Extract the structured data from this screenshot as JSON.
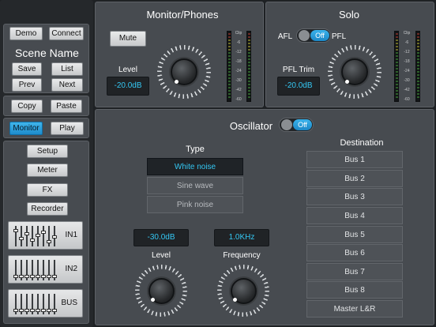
{
  "sidebar": {
    "demo": "Demo",
    "connect": "Connect",
    "scene_name": "Scene Name",
    "save": "Save",
    "list": "List",
    "prev": "Prev",
    "next": "Next",
    "copy": "Copy",
    "paste": "Paste",
    "monitor": "Monitor",
    "play": "Play",
    "setup": "Setup",
    "meter": "Meter",
    "fx": "FX",
    "recorder": "Recorder",
    "fader_in1": "IN1",
    "fader_in2": "IN2",
    "fader_bus": "BUS"
  },
  "monitor": {
    "title": "Monitor/Phones",
    "mute": "Mute",
    "level_label": "Level",
    "level_value": "-20.0dB",
    "scale": [
      "Clip",
      "-6",
      "-12",
      "-18",
      "-24",
      "-30",
      "-42",
      "-60"
    ]
  },
  "solo": {
    "title": "Solo",
    "afl": "AFL",
    "pfl": "PFL",
    "toggle_state": "Off",
    "pfl_trim_label": "PFL Trim",
    "pfl_trim_value": "-20.0dB",
    "scale": [
      "Clip",
      "-6",
      "-12",
      "-18",
      "-24",
      "-30",
      "-42",
      "-60"
    ]
  },
  "oscillator": {
    "title": "Oscillator",
    "toggle_state": "Off",
    "type_label": "Type",
    "types": [
      "White noise",
      "Sine wave",
      "Pink noise"
    ],
    "selected_type": "White noise",
    "level_value": "-30.0dB",
    "level_label": "Level",
    "frequency_value": "1.0KHz",
    "frequency_label": "Frequency",
    "destination_label": "Destination",
    "destinations": [
      "Bus 1",
      "Bus 2",
      "Bus 3",
      "Bus 4",
      "Bus 5",
      "Bus 6",
      "Bus 7",
      "Bus 8",
      "Master L&R"
    ]
  },
  "colors": {
    "accent": "#34c7f3",
    "active_button": "#1e8ccc",
    "panel": "#474b50"
  }
}
